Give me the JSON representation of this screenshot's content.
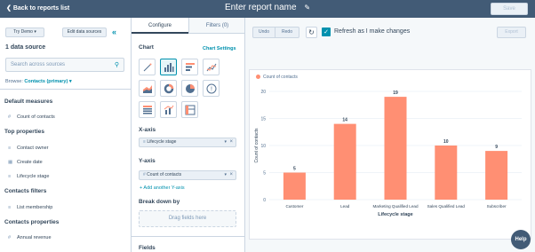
{
  "topbar": {
    "back_label": "Back to reports list",
    "title": "Enter report name",
    "save_label": "Save"
  },
  "left": {
    "try_demo": "Try Demo",
    "edit_sources": "Edit data sources",
    "data_source_count": "1 data source",
    "search_placeholder": "Search across sources",
    "browse_label": "Browse:",
    "browse_value": "Contacts (primary)",
    "sections": [
      {
        "title": "Default measures",
        "items": [
          "Count of contacts"
        ]
      },
      {
        "title": "Top properties",
        "items": [
          "Contact owner",
          "Create date",
          "Lifecycle stage"
        ]
      },
      {
        "title": "Contacts filters",
        "items": [
          "List membership"
        ]
      },
      {
        "title": "Contacts properties",
        "items": [
          "Annual revenue"
        ]
      }
    ]
  },
  "mid": {
    "tab_configure": "Configure",
    "tab_filters": "Filters (0)",
    "chart_label": "Chart",
    "chart_settings": "Chart Settings",
    "xaxis_label": "X-axis",
    "xaxis_value": "Lifecycle stage",
    "yaxis_label": "Y-axis",
    "yaxis_value": "Count of contacts",
    "add_yaxis": "+ Add another Y-axis",
    "breakdown_label": "Break down by",
    "drag_fields": "Drag fields here",
    "fields_label": "Fields"
  },
  "toolbar": {
    "undo": "Undo",
    "redo": "Redo",
    "refresh_label": "Refresh as I make changes",
    "export": "Export"
  },
  "help_label": "Help",
  "colors": {
    "bar": "#ff8f73",
    "topbar": "#425b76",
    "accent": "#0091ae"
  },
  "chart_data": {
    "type": "bar",
    "categories": [
      "Customer",
      "Lead",
      "Marketing Qualified Lead",
      "Sales Qualified Lead",
      "Subscriber"
    ],
    "series": [
      {
        "name": "Count of contacts",
        "values": [
          5,
          14,
          19,
          10,
          9
        ]
      }
    ],
    "xlabel": "Lifecycle stage",
    "ylabel": "Count of contacts",
    "ylim": [
      0,
      20
    ],
    "yticks": [
      0,
      5,
      10,
      15,
      20
    ],
    "legend": "top-left",
    "grid": true
  }
}
